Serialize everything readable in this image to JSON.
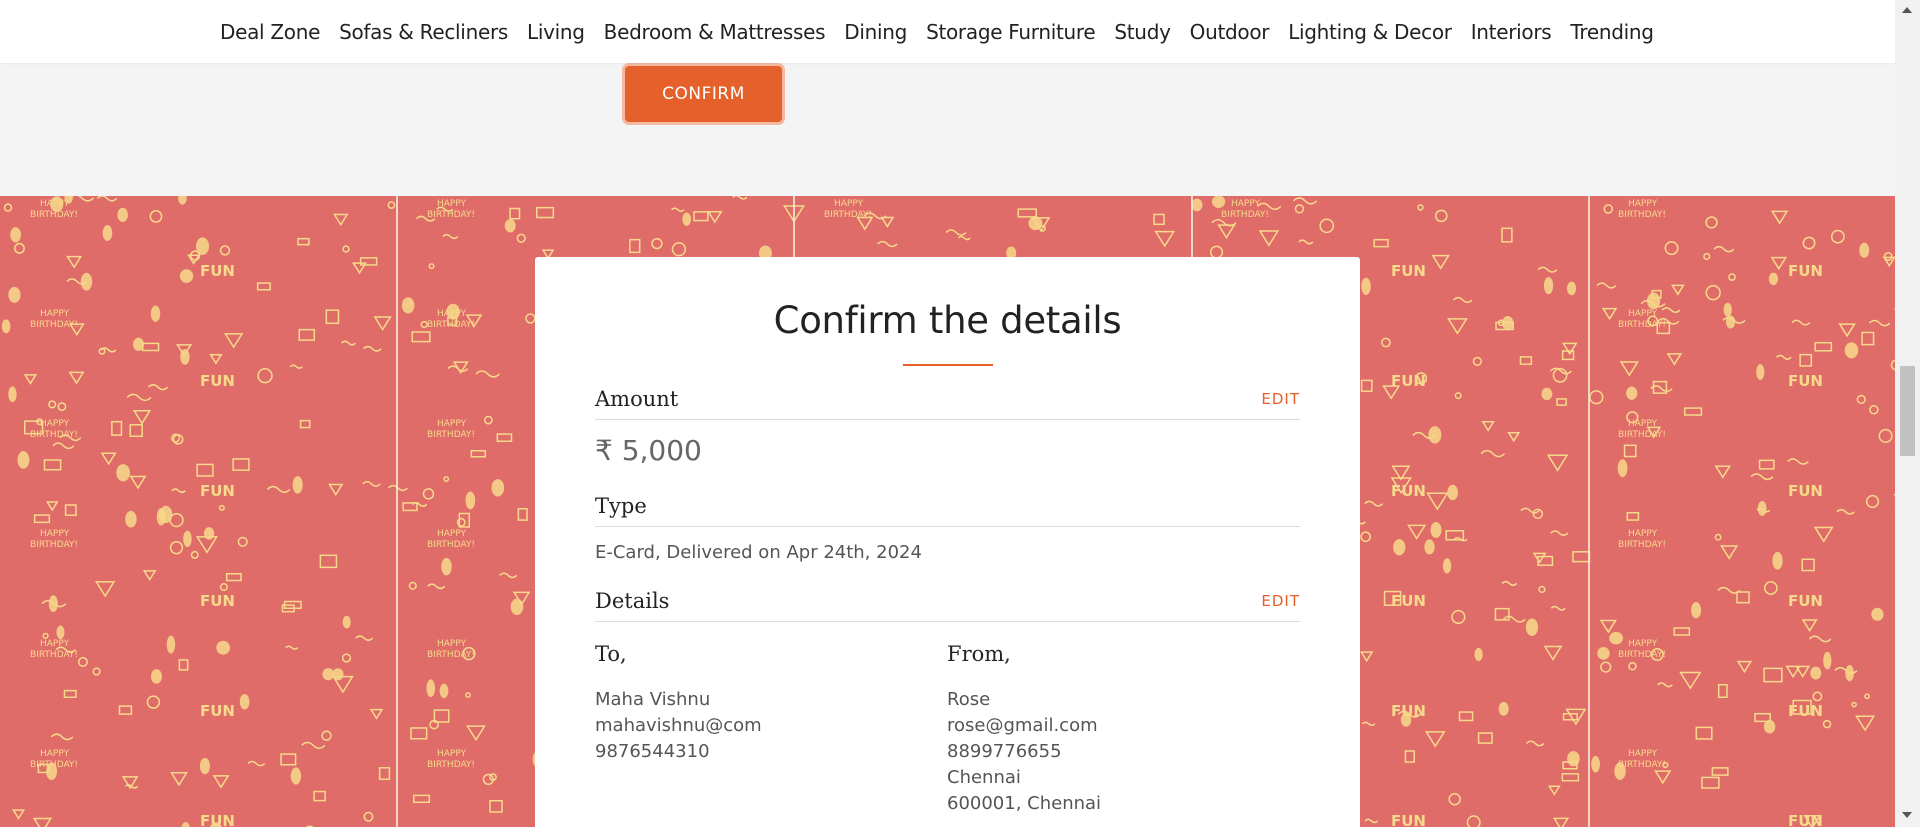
{
  "nav": {
    "items": [
      "Deal Zone",
      "Sofas & Recliners",
      "Living",
      "Bedroom & Mattresses",
      "Dining",
      "Storage Furniture",
      "Study",
      "Outdoor",
      "Lighting & Decor",
      "Interiors",
      "Trending"
    ]
  },
  "confirm_button": "CONFIRM",
  "card": {
    "title": "Confirm the details",
    "amount_label": "Amount",
    "edit_label": "EDIT",
    "amount_value": "₹ 5,000",
    "type_label": "Type",
    "type_value": "E-Card, Delivered on Apr 24th, 2024",
    "details_label": "Details",
    "to": {
      "heading": "To,",
      "lines": [
        "Maha Vishnu",
        "mahavishnu@com",
        "9876544310"
      ]
    },
    "from": {
      "heading": "From,",
      "lines": [
        "Rose",
        "rose@gmail.com",
        "8899776655",
        "Chennai",
        "600001, Chennai"
      ]
    }
  },
  "colors": {
    "accent": "#e5602a",
    "pattern_bg": "#e06c6a",
    "pattern_fg": "#f6d98a"
  },
  "pattern": {
    "texts": [
      "HAPPY",
      "BIRTHDAY!",
      "FUN"
    ]
  }
}
